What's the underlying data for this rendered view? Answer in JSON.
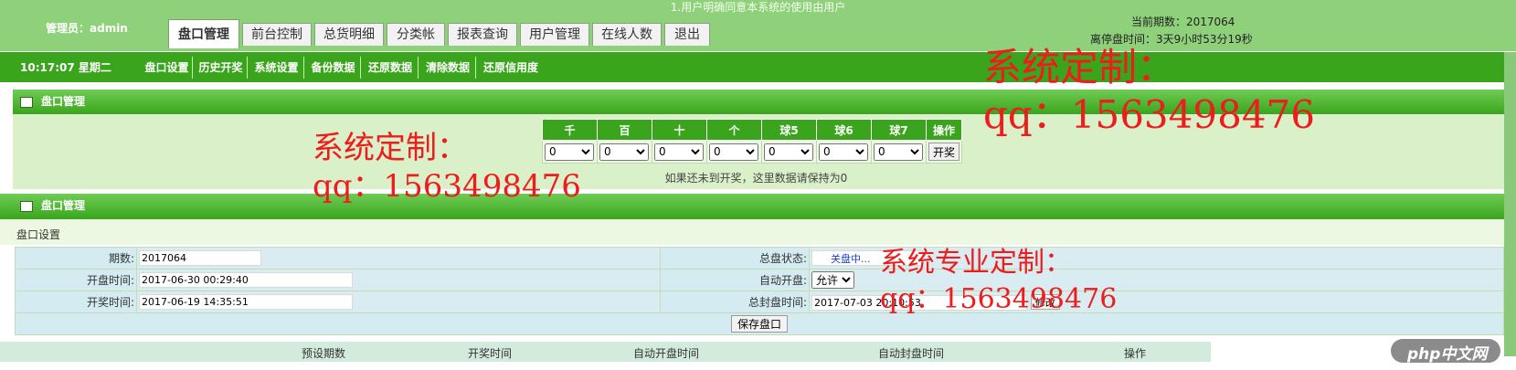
{
  "header": {
    "notice": "1.用户明确同意本系统的使用由用户",
    "admin_label": "管理员：admin",
    "period": "当前期数：2017064",
    "close_countdown": "离停盘时间：3天9小时53分19秒",
    "tabs": [
      {
        "label": "盘口管理",
        "active": true
      },
      {
        "label": "前台控制"
      },
      {
        "label": "总货明细"
      },
      {
        "label": "分类帐"
      },
      {
        "label": "报表查询"
      },
      {
        "label": "用户管理"
      },
      {
        "label": "在线人数"
      },
      {
        "label": "退出"
      }
    ]
  },
  "subnav": {
    "clock": "10:17:07 星期二",
    "items": [
      "盘口设置",
      "历史开奖",
      "系统设置",
      "备份数据",
      "还原数据",
      "清除数据",
      "还原信用度"
    ]
  },
  "panel1": {
    "title": "盘口管理",
    "columns": [
      "千",
      "百",
      "十",
      "个",
      "球5",
      "球6",
      "球7",
      "操作"
    ],
    "selects": [
      "0",
      "0",
      "0",
      "0",
      "0",
      "0",
      "0"
    ],
    "action_label": "开奖",
    "hint": "如果还未到开奖，这里数据请保持为0"
  },
  "panel2": {
    "title": "盘口管理",
    "section": "盘口设置",
    "rows": [
      {
        "label": "期数:",
        "value": "2017064",
        "right_label": "总盘状态:"
      },
      {
        "label": "开盘时间:",
        "value": "2017-06-30 00:29:40",
        "right_label": "自动开盘:"
      },
      {
        "label": "开奖时间:",
        "value": "2017-06-19 14:35:51",
        "right_label": "总封盘时间:"
      }
    ],
    "state_link": "关盘中...",
    "auto_open_value": "允许",
    "close_time_value": "2017-07-03 20:10:53",
    "change_label": "修改",
    "save_label": "保存盘口"
  },
  "bottom_headers": [
    "预设期数",
    "开奖时间",
    "自动开盘时间",
    "自动封盘时间",
    "操作"
  ],
  "watermarks": {
    "brand": "系统定制：",
    "qq": "qq：1563498476",
    "pro": "系统专业定制：",
    "logo": "php中文网"
  },
  "colors": {
    "header_green": "#8fd07a",
    "subnav_green": "#3aa51c",
    "panel_bg": "#d9f0c8",
    "watermark_red": "#ee1c1c"
  }
}
